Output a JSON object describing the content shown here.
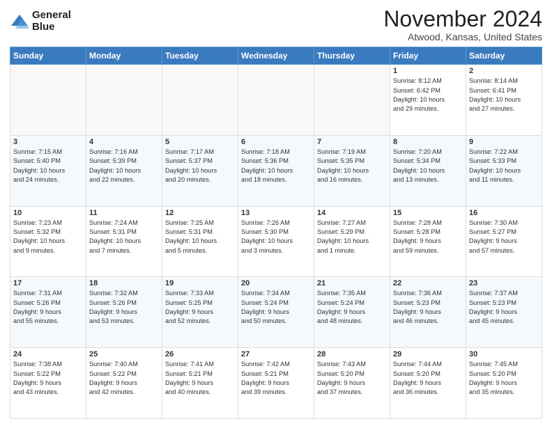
{
  "header": {
    "logo_line1": "General",
    "logo_line2": "Blue",
    "month": "November 2024",
    "location": "Atwood, Kansas, United States"
  },
  "weekdays": [
    "Sunday",
    "Monday",
    "Tuesday",
    "Wednesday",
    "Thursday",
    "Friday",
    "Saturday"
  ],
  "weeks": [
    [
      {
        "day": "",
        "info": ""
      },
      {
        "day": "",
        "info": ""
      },
      {
        "day": "",
        "info": ""
      },
      {
        "day": "",
        "info": ""
      },
      {
        "day": "",
        "info": ""
      },
      {
        "day": "1",
        "info": "Sunrise: 8:12 AM\nSunset: 6:42 PM\nDaylight: 10 hours\nand 29 minutes."
      },
      {
        "day": "2",
        "info": "Sunrise: 8:14 AM\nSunset: 6:41 PM\nDaylight: 10 hours\nand 27 minutes."
      }
    ],
    [
      {
        "day": "3",
        "info": "Sunrise: 7:15 AM\nSunset: 5:40 PM\nDaylight: 10 hours\nand 24 minutes."
      },
      {
        "day": "4",
        "info": "Sunrise: 7:16 AM\nSunset: 5:39 PM\nDaylight: 10 hours\nand 22 minutes."
      },
      {
        "day": "5",
        "info": "Sunrise: 7:17 AM\nSunset: 5:37 PM\nDaylight: 10 hours\nand 20 minutes."
      },
      {
        "day": "6",
        "info": "Sunrise: 7:18 AM\nSunset: 5:36 PM\nDaylight: 10 hours\nand 18 minutes."
      },
      {
        "day": "7",
        "info": "Sunrise: 7:19 AM\nSunset: 5:35 PM\nDaylight: 10 hours\nand 16 minutes."
      },
      {
        "day": "8",
        "info": "Sunrise: 7:20 AM\nSunset: 5:34 PM\nDaylight: 10 hours\nand 13 minutes."
      },
      {
        "day": "9",
        "info": "Sunrise: 7:22 AM\nSunset: 5:33 PM\nDaylight: 10 hours\nand 11 minutes."
      }
    ],
    [
      {
        "day": "10",
        "info": "Sunrise: 7:23 AM\nSunset: 5:32 PM\nDaylight: 10 hours\nand 9 minutes."
      },
      {
        "day": "11",
        "info": "Sunrise: 7:24 AM\nSunset: 5:31 PM\nDaylight: 10 hours\nand 7 minutes."
      },
      {
        "day": "12",
        "info": "Sunrise: 7:25 AM\nSunset: 5:31 PM\nDaylight: 10 hours\nand 5 minutes."
      },
      {
        "day": "13",
        "info": "Sunrise: 7:26 AM\nSunset: 5:30 PM\nDaylight: 10 hours\nand 3 minutes."
      },
      {
        "day": "14",
        "info": "Sunrise: 7:27 AM\nSunset: 5:29 PM\nDaylight: 10 hours\nand 1 minute."
      },
      {
        "day": "15",
        "info": "Sunrise: 7:28 AM\nSunset: 5:28 PM\nDaylight: 9 hours\nand 59 minutes."
      },
      {
        "day": "16",
        "info": "Sunrise: 7:30 AM\nSunset: 5:27 PM\nDaylight: 9 hours\nand 57 minutes."
      }
    ],
    [
      {
        "day": "17",
        "info": "Sunrise: 7:31 AM\nSunset: 5:26 PM\nDaylight: 9 hours\nand 55 minutes."
      },
      {
        "day": "18",
        "info": "Sunrise: 7:32 AM\nSunset: 5:26 PM\nDaylight: 9 hours\nand 53 minutes."
      },
      {
        "day": "19",
        "info": "Sunrise: 7:33 AM\nSunset: 5:25 PM\nDaylight: 9 hours\nand 52 minutes."
      },
      {
        "day": "20",
        "info": "Sunrise: 7:34 AM\nSunset: 5:24 PM\nDaylight: 9 hours\nand 50 minutes."
      },
      {
        "day": "21",
        "info": "Sunrise: 7:35 AM\nSunset: 5:24 PM\nDaylight: 9 hours\nand 48 minutes."
      },
      {
        "day": "22",
        "info": "Sunrise: 7:36 AM\nSunset: 5:23 PM\nDaylight: 9 hours\nand 46 minutes."
      },
      {
        "day": "23",
        "info": "Sunrise: 7:37 AM\nSunset: 5:23 PM\nDaylight: 9 hours\nand 45 minutes."
      }
    ],
    [
      {
        "day": "24",
        "info": "Sunrise: 7:38 AM\nSunset: 5:22 PM\nDaylight: 9 hours\nand 43 minutes."
      },
      {
        "day": "25",
        "info": "Sunrise: 7:40 AM\nSunset: 5:22 PM\nDaylight: 9 hours\nand 42 minutes."
      },
      {
        "day": "26",
        "info": "Sunrise: 7:41 AM\nSunset: 5:21 PM\nDaylight: 9 hours\nand 40 minutes."
      },
      {
        "day": "27",
        "info": "Sunrise: 7:42 AM\nSunset: 5:21 PM\nDaylight: 9 hours\nand 39 minutes."
      },
      {
        "day": "28",
        "info": "Sunrise: 7:43 AM\nSunset: 5:20 PM\nDaylight: 9 hours\nand 37 minutes."
      },
      {
        "day": "29",
        "info": "Sunrise: 7:44 AM\nSunset: 5:20 PM\nDaylight: 9 hours\nand 36 minutes."
      },
      {
        "day": "30",
        "info": "Sunrise: 7:45 AM\nSunset: 5:20 PM\nDaylight: 9 hours\nand 35 minutes."
      }
    ]
  ]
}
